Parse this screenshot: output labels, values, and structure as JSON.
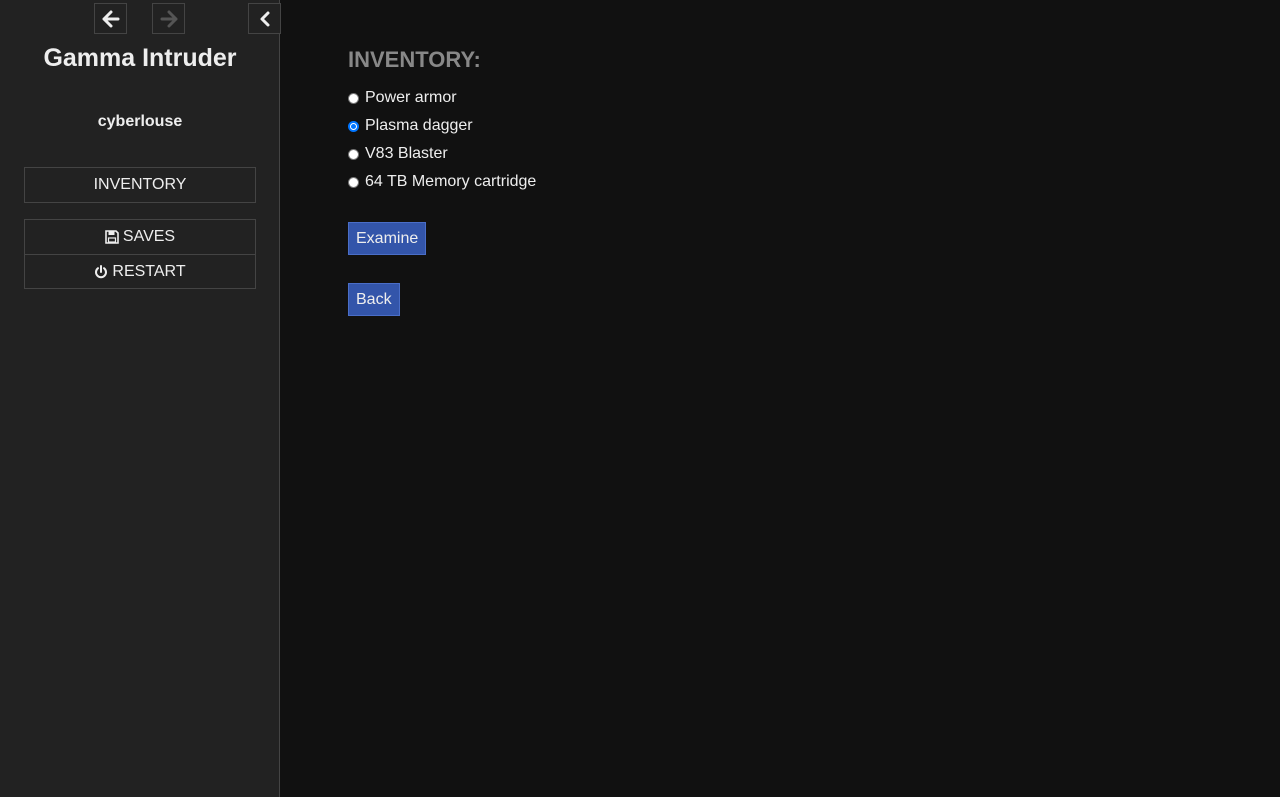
{
  "sidebar": {
    "title": "Gamma Intruder",
    "author": "cyberlouse",
    "nav": {
      "back_icon": "arrow-left-icon",
      "forward_icon": "arrow-right-icon",
      "collapse_icon": "chevron-left-icon"
    },
    "menu": {
      "inventory_label": "INVENTORY",
      "saves_label": "SAVES",
      "restart_label": "RESTART",
      "saves_icon": "floppy-disk-icon",
      "restart_icon": "power-icon"
    }
  },
  "main": {
    "heading": "INVENTORY:",
    "items": [
      {
        "label": "Power armor",
        "selected": false
      },
      {
        "label": "Plasma dagger",
        "selected": true
      },
      {
        "label": "V83 Blaster",
        "selected": false
      },
      {
        "label": "64 TB Memory cartridge",
        "selected": false
      }
    ],
    "examine_label": "Examine",
    "back_label": "Back"
  },
  "colors": {
    "background": "#111111",
    "sidebar_bg": "#222222",
    "border": "#444444",
    "heading": "#888888",
    "button_bg": "#3355aa",
    "radio_selected": "#0075ff",
    "text": "#eeeeee",
    "disabled_icon": "#555555"
  }
}
